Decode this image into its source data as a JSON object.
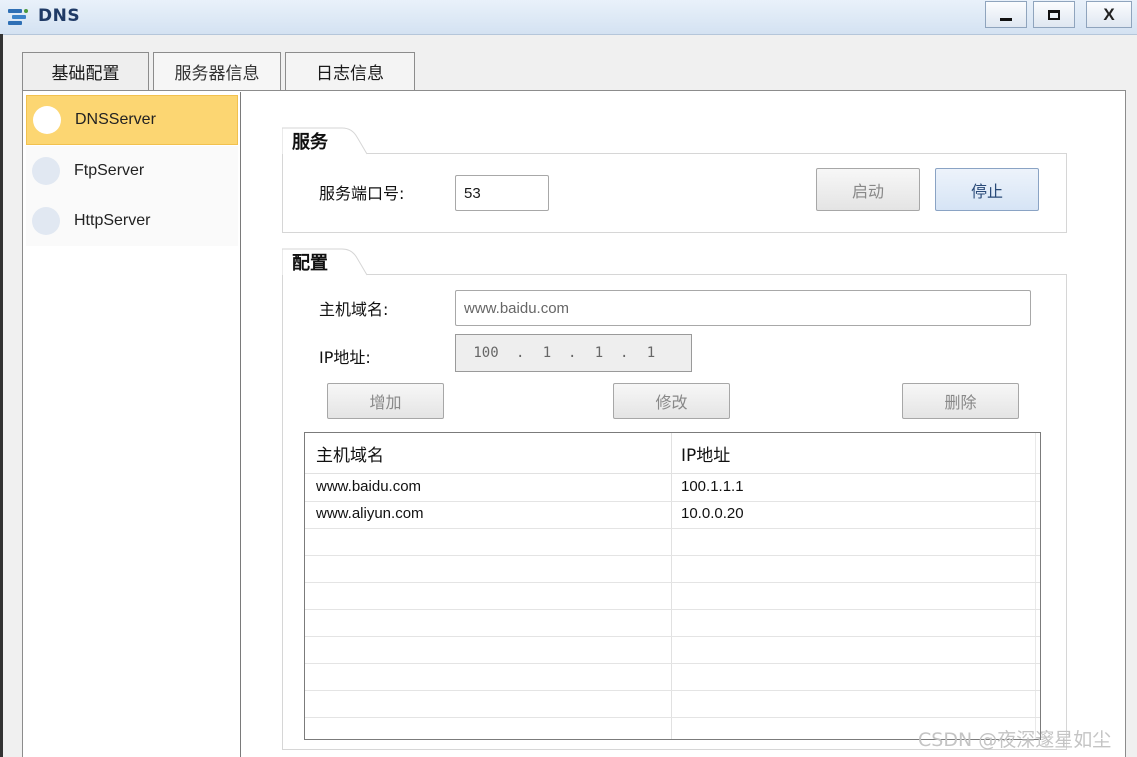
{
  "window": {
    "title": "DNS",
    "min_label": "minimize",
    "max_label": "maximize",
    "close_label": "X"
  },
  "tabs": [
    {
      "label": "基础配置",
      "selected": false
    },
    {
      "label": "服务器信息",
      "selected": true
    },
    {
      "label": "日志信息",
      "selected": false
    }
  ],
  "sidebar": {
    "items": [
      {
        "label": "DNSServer",
        "active": true
      },
      {
        "label": "FtpServer",
        "active": false
      },
      {
        "label": "HttpServer",
        "active": false
      }
    ]
  },
  "service": {
    "group_title": "服务",
    "port_label": "服务端口号:",
    "port_value": "53",
    "start_label": "启动",
    "stop_label": "停止"
  },
  "config": {
    "group_title": "配置",
    "host_label": "主机域名:",
    "host_value": "www.baidu.com",
    "ip_label": "IP地址:",
    "ip_segments": [
      "100",
      "1",
      "1",
      "1"
    ],
    "add_label": "增加",
    "modify_label": "修改",
    "delete_label": "删除"
  },
  "table": {
    "columns": [
      "主机域名",
      "IP地址"
    ],
    "rows": [
      [
        "www.baidu.com",
        "100.1.1.1"
      ],
      [
        "www.aliyun.com",
        "10.0.0.20"
      ]
    ]
  },
  "watermark": "CSDN @夜深邃星如尘",
  "colors": {
    "accent_active": "#fcd672",
    "titlebar": "#d4e2f2",
    "stop_button": "#d6e4f5"
  }
}
